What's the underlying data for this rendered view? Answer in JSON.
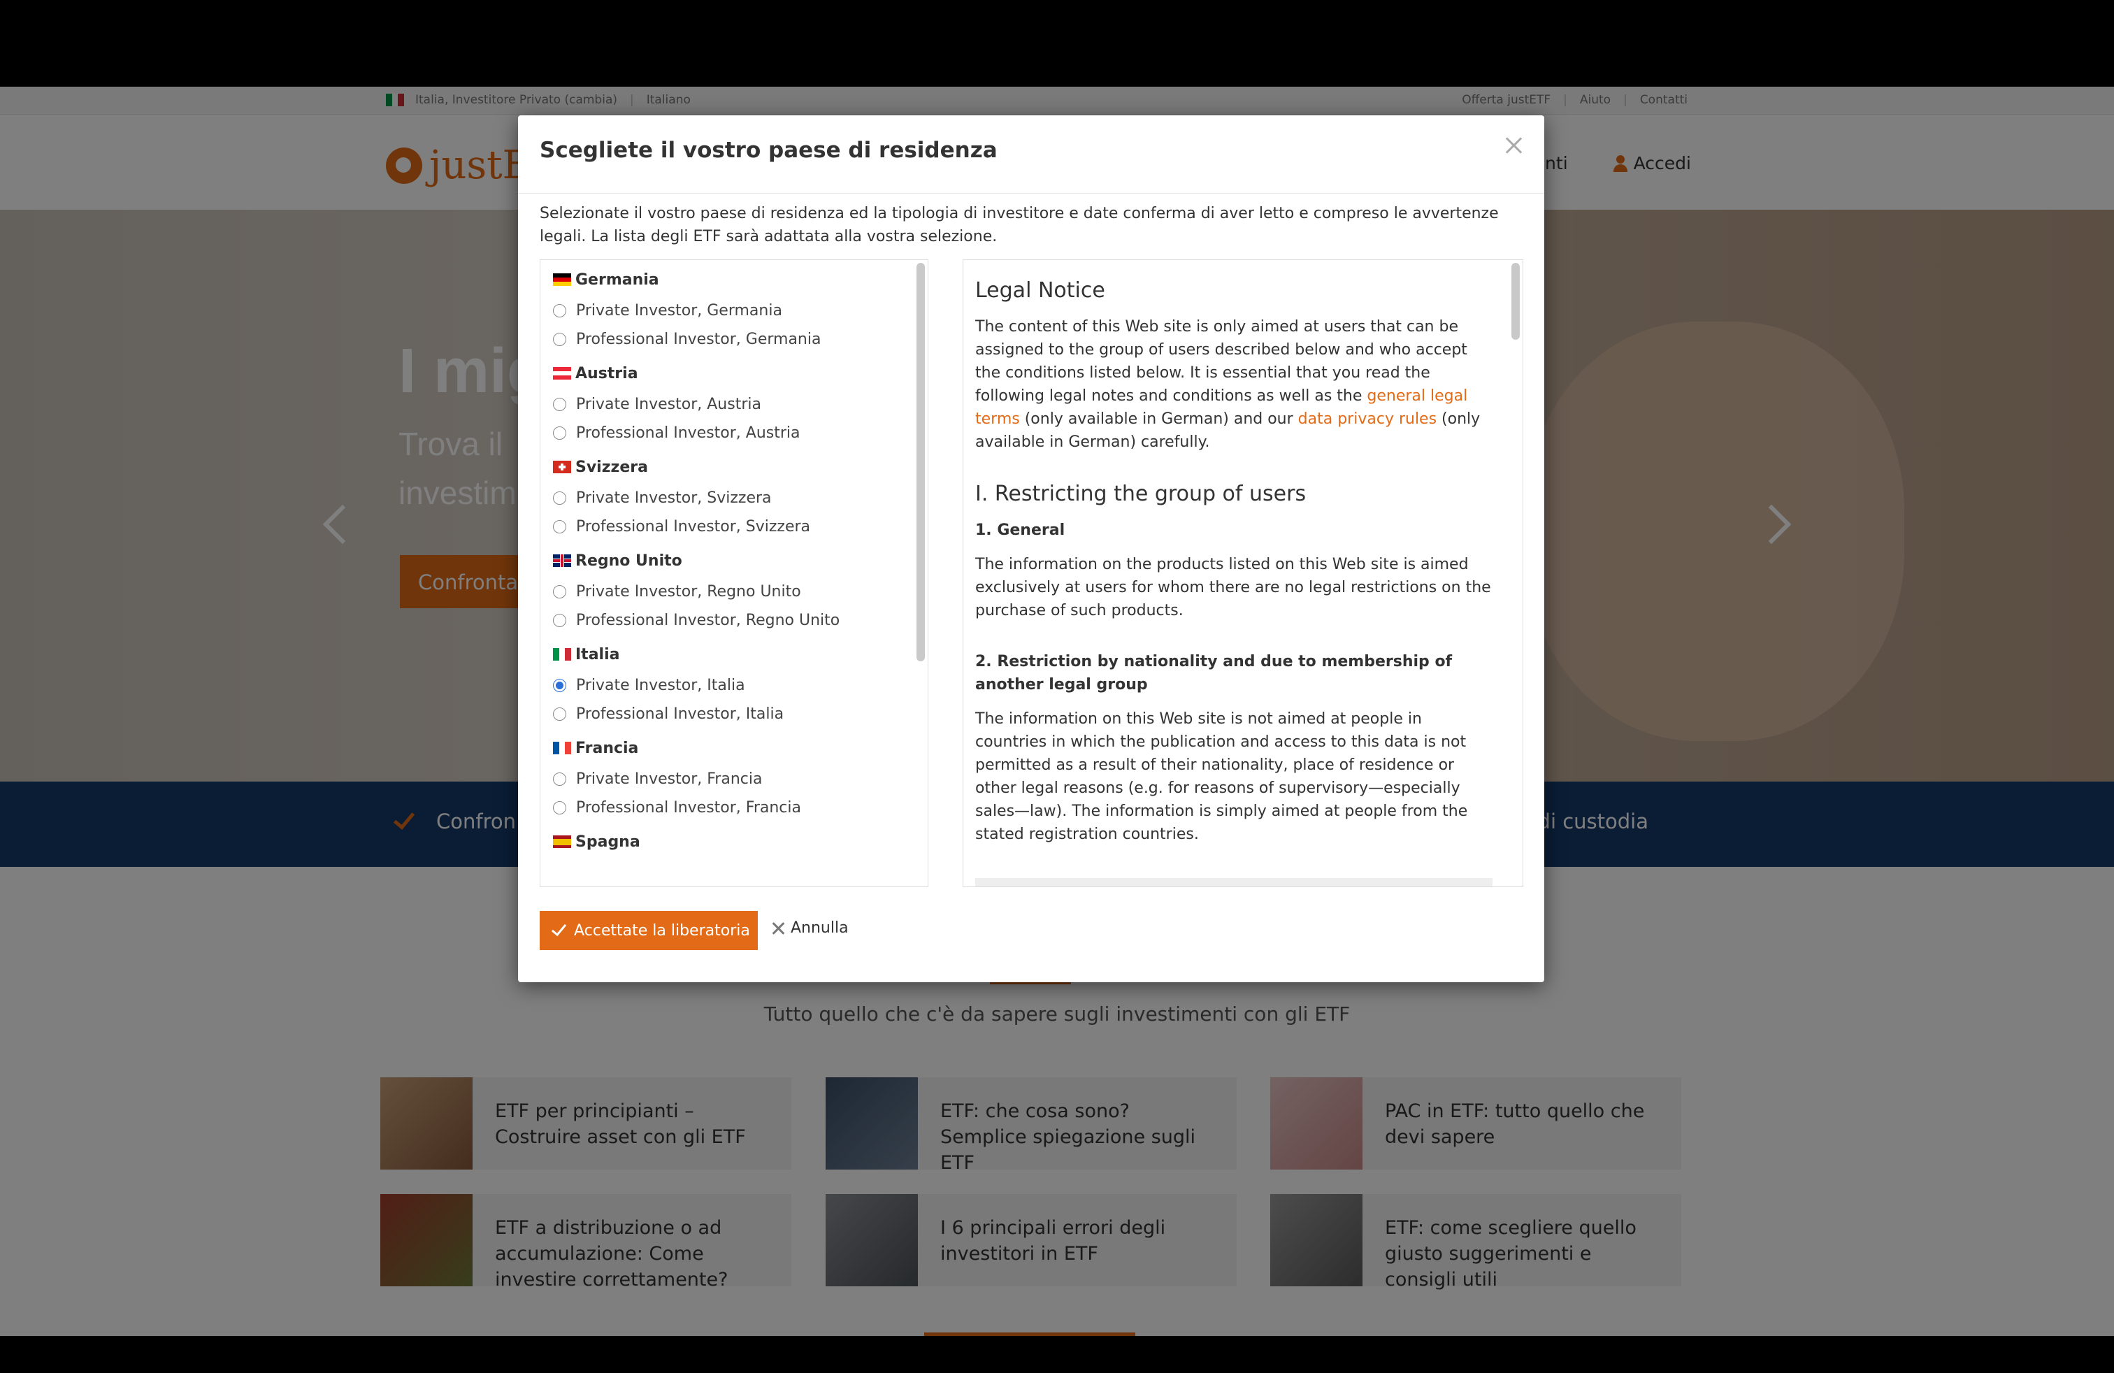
{
  "topbar": {
    "location": "Italia, Investitore Privato (cambia)",
    "language": "Italiano",
    "links": [
      "Offerta justETF",
      "Aiuto",
      "Contatti"
    ]
  },
  "header": {
    "logo_text": "justETF",
    "nav_partial": "onti",
    "login_label": "Accedi"
  },
  "hero": {
    "headline": "I mig",
    "subline": "Trova il investim",
    "cta_label": "Confronta"
  },
  "strip": {
    "left_text": "Confron",
    "right_text": "di custodia"
  },
  "guides": {
    "subtitle": "Tutto quello che c'è da sapere sugli investimenti con gli ETF",
    "cards": [
      "ETF per principianti – Costruire asset con gli ETF",
      "ETF: che cosa sono? Semplice spiegazione sugli ETF",
      "PAC in ETF: tutto quello che devi sapere",
      "ETF a distribuzione o ad accumulazione: Come investire correttamente?",
      "I 6 principali errori degli investitori in ETF",
      "ETF: come scegliere quello giusto suggerimenti e consigli utili"
    ]
  },
  "modal": {
    "title": "Scegliete il vostro paese di residenza",
    "intro": "Selezionate il vostro paese di residenza ed la tipologia di investitore e date conferma di aver letto e compreso le avvertenze legali. La lista degli ETF sarà adattata alla vostra selezione.",
    "countries": [
      {
        "name": "Germania",
        "options": [
          "Private Investor, Germania",
          "Professional Investor, Germania"
        ]
      },
      {
        "name": "Austria",
        "options": [
          "Private Investor, Austria",
          "Professional Investor, Austria"
        ]
      },
      {
        "name": "Svizzera",
        "options": [
          "Private Investor, Svizzera",
          "Professional Investor, Svizzera"
        ]
      },
      {
        "name": "Regno Unito",
        "options": [
          "Private Investor, Regno Unito",
          "Professional Investor, Regno Unito"
        ]
      },
      {
        "name": "Italia",
        "options": [
          "Private Investor, Italia",
          "Professional Investor, Italia"
        ]
      },
      {
        "name": "Francia",
        "options": [
          "Private Investor, Francia",
          "Professional Investor, Francia"
        ]
      },
      {
        "name": "Spagna",
        "options": []
      }
    ],
    "selected_option": "Private Investor, Italia",
    "legal": {
      "title": "Legal Notice",
      "intro_before_link1": "The content of this Web site is only aimed at users that can be assigned to the group of users described below and who accept the conditions listed below. It is essential that you read the following legal notes and conditions as well as the ",
      "link1": "general legal terms",
      "intro_between": " (only available in German) and our ",
      "link2": "data privacy rules",
      "intro_after": " (only available in German) carefully.",
      "section1_title": "I. Restricting the group of users",
      "sub1_title": "1. General",
      "sub1_text": "The information on the products listed on this Web site is aimed exclusively at users for whom there are no legal restrictions on the purchase of such products.",
      "sub2_title": "2. Restriction by nationality and due to membership of another legal group",
      "sub2_text": "The information on this Web site is not aimed at people in countries in which the publication and access to this data is not permitted as a result of their nationality, place of residence or other legal reasons (e.g. for reasons of supervisory—especially sales—law). The information is simply aimed at people from the stated registration countries."
    },
    "accept_label": "Accettate la liberatoria",
    "cancel_label": "Annulla"
  },
  "colors": {
    "accent": "#e36b17",
    "navy": "#153a6b",
    "radio_selected": "#2a6fd8"
  }
}
